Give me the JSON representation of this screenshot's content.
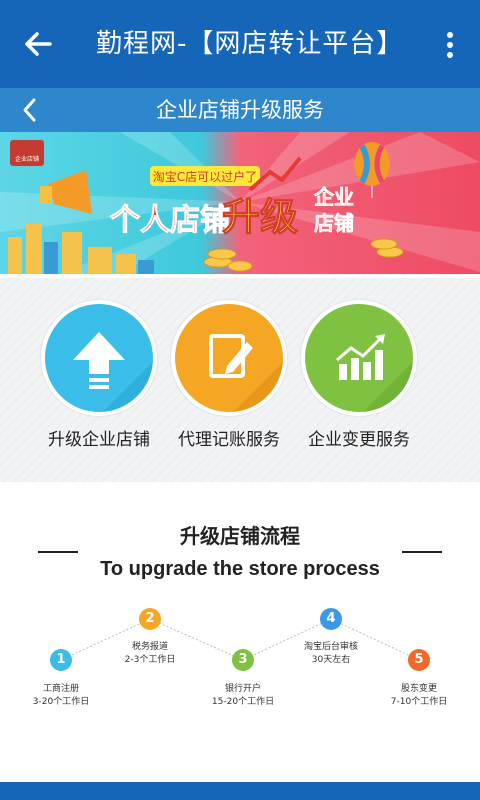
{
  "appbar": {
    "title": "勤程网-【网店转让平台】",
    "back_icon": "arrow-left-icon",
    "menu_icon": "more-vert-icon",
    "color": "#1565b8"
  },
  "subbar": {
    "title": "企业店铺升级服务",
    "back_icon": "chevron-left-icon",
    "color": "#2e87cc"
  },
  "banner": {
    "badge_text": "企业店铺",
    "tag_text": "淘宝C店可以过户了",
    "headline_part1": "个人店铺",
    "headline_part2": "升级",
    "headline_part3a": "企业",
    "headline_part3b": "店铺"
  },
  "services": [
    {
      "label": "升级企业店铺",
      "icon": "upload-arrow-icon",
      "color": "#3bbde9"
    },
    {
      "label": "代理记账服务",
      "icon": "edit-document-icon",
      "color": "#f5a623"
    },
    {
      "label": "企业变更服务",
      "icon": "growth-chart-icon",
      "color": "#7fc241"
    }
  ],
  "process": {
    "title": "升级店铺流程",
    "subtitle": "To upgrade the store process",
    "steps": [
      {
        "num": "1",
        "name": "工商注册",
        "duration": "3-20个工作日",
        "color": "#3bbde9"
      },
      {
        "num": "2",
        "name": "税务报道",
        "duration": "2-3个工作日",
        "color": "#f5a623"
      },
      {
        "num": "3",
        "name": "银行开户",
        "duration": "15-20个工作日",
        "color": "#7fc241"
      },
      {
        "num": "4",
        "name": "淘宝后台审核",
        "duration": "30天左右",
        "color": "#3b98e9"
      },
      {
        "num": "5",
        "name": "股东变更",
        "duration": "7-10个工作日",
        "color": "#f2672a"
      }
    ]
  }
}
